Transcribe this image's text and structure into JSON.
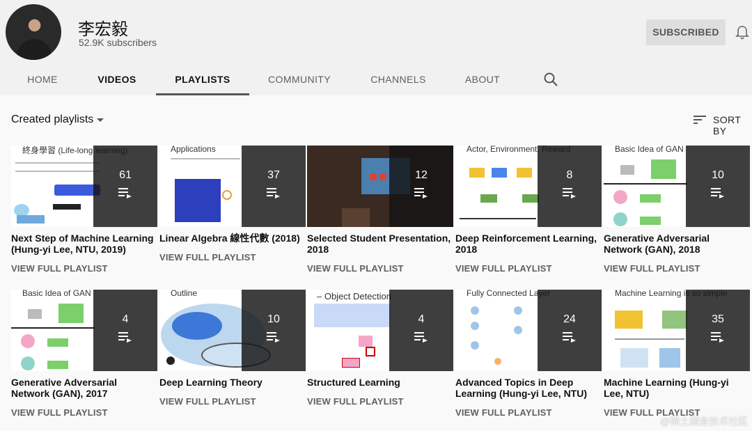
{
  "channel": {
    "name": "李宏毅",
    "subscribers": "52.9K subscribers",
    "subscribe_label": "SUBSCRIBED"
  },
  "tabs": [
    "HOME",
    "VIDEOS",
    "PLAYLISTS",
    "COMMUNITY",
    "CHANNELS",
    "ABOUT"
  ],
  "section": {
    "title": "Created playlists",
    "sort_label": "SORT BY"
  },
  "view_label": "VIEW FULL PLAYLIST",
  "playlists": [
    {
      "title": "Next Step of Machine Learning (Hung-yi Lee, NTU, 2019)",
      "count": "61",
      "thumb_text": "終身學習 (Life-long learning)"
    },
    {
      "title": "Linear Algebra 線性代數 (2018)",
      "count": "37",
      "thumb_text": "Applications"
    },
    {
      "title": "Selected Student Presentation, 2018",
      "count": "12",
      "thumb_text": ""
    },
    {
      "title": "Deep Reinforcement Learning, 2018",
      "count": "8",
      "thumb_text": "Actor, Environment, Reward"
    },
    {
      "title": "Generative Adversarial Network (GAN), 2018",
      "count": "10",
      "thumb_text": "Basic Idea of GAN"
    },
    {
      "title": "Generative Adversarial Network (GAN), 2017",
      "count": "4",
      "thumb_text": "Basic Idea of GAN"
    },
    {
      "title": "Deep Learning Theory",
      "count": "10",
      "thumb_text": "Outline"
    },
    {
      "title": "Structured Learning",
      "count": "4",
      "thumb_text": "– Object Detection"
    },
    {
      "title": "Advanced Topics in Deep Learning (Hung-yi Lee, NTU)",
      "count": "24",
      "thumb_text": "Fully Connected Layer"
    },
    {
      "title": "Machine Learning (Hung-yi Lee, NTU)",
      "count": "35",
      "thumb_text": "Machine Learning is so simple"
    }
  ],
  "watermark": "@稀土掘金技术社区",
  "colors": {
    "overlay": "#141414",
    "active_tab_underline": "#555555",
    "subscribe_bg": "#dedede"
  }
}
